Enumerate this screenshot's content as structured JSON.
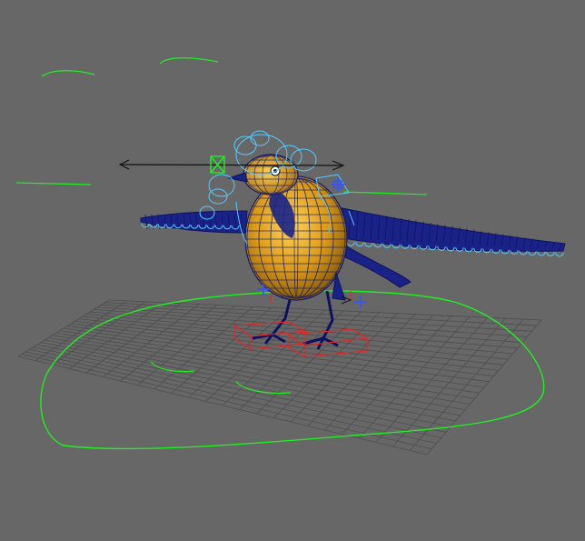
{
  "viewport": {
    "label": "",
    "colors": {
      "background": "#676767",
      "grid": "#4f4f4f",
      "control_curve": "#22ee22",
      "rig_curve": "#55ccff",
      "body_fill": "#e2a21a",
      "body_wire": "#101870",
      "foot_box": "#ee2222",
      "manipulator": "#111111",
      "pivot": "#3355ff"
    },
    "icons": [
      "move-arrow-icon",
      "locator-cross-icon",
      "pivot-cross-icon"
    ]
  }
}
